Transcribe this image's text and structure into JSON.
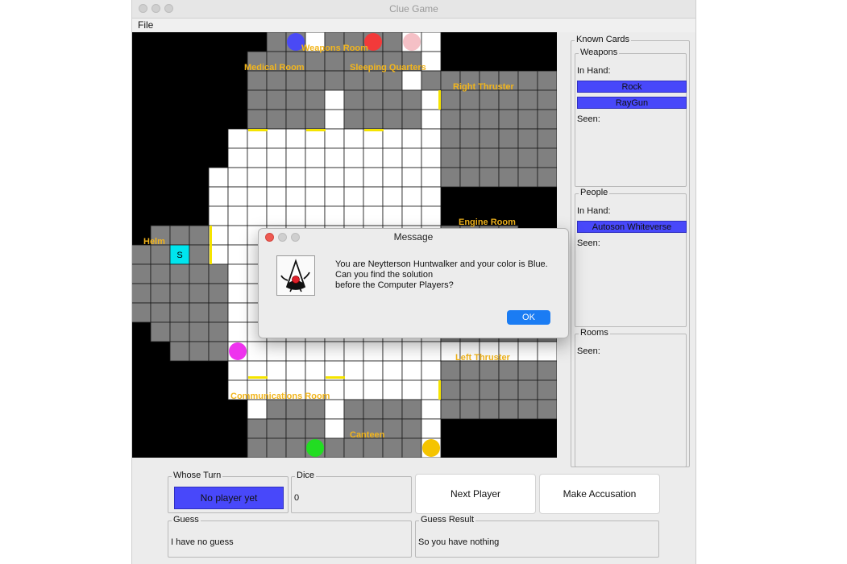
{
  "window": {
    "title": "Clue Game",
    "menu_file": "File"
  },
  "board": {
    "cols": 22,
    "rows": 22,
    "rooms": {
      "medical": "Medical Room",
      "weapons": "Weapons Room",
      "sleeping": "Sleeping Quarters",
      "right_thruster": "Right Thruster",
      "engine": "Engine Room",
      "helm": "Helm",
      "left_thruster": "Left Thruster",
      "communications": "Communications Room",
      "canteen": "Canteen"
    },
    "start_marker": "S",
    "colors": {
      "walkway": "#ffffff",
      "room": "#808080",
      "void": "#000000",
      "start": "#00e5ee",
      "door": "#f5e400"
    }
  },
  "players": [
    {
      "color": "#4a4af5"
    },
    {
      "color": "#f23a3a"
    },
    {
      "color": "#f5c0c6"
    },
    {
      "color": "#ee33ee"
    },
    {
      "color": "#22dd22"
    },
    {
      "color": "#f5c400"
    }
  ],
  "known_cards": {
    "title": "Known Cards",
    "weapons": {
      "title": "Weapons",
      "in_hand_label": "In Hand:",
      "in_hand": [
        "Rock",
        "RayGun"
      ],
      "seen_label": "Seen:"
    },
    "people": {
      "title": "People",
      "in_hand_label": "In Hand:",
      "in_hand": [
        "Autoson Whiteverse"
      ],
      "seen_label": "Seen:"
    },
    "rooms": {
      "title": "Rooms",
      "seen_label": "Seen:"
    }
  },
  "controls": {
    "whose_turn_title": "Whose Turn",
    "whose_turn_value": "No player yet",
    "dice_title": "Dice",
    "dice_value": "0",
    "next_player": "Next Player",
    "make_accusation": "Make Accusation",
    "guess_title": "Guess",
    "guess_value": "I have no guess",
    "guess_result_title": "Guess Result",
    "guess_result_value": "So you have nothing"
  },
  "dialog": {
    "title": "Message",
    "line1": "You are Neytterson Huntwalker and your color is Blue.",
    "line2": "Can you find the solution",
    "line3": "before the Computer Players?",
    "ok": "OK"
  }
}
